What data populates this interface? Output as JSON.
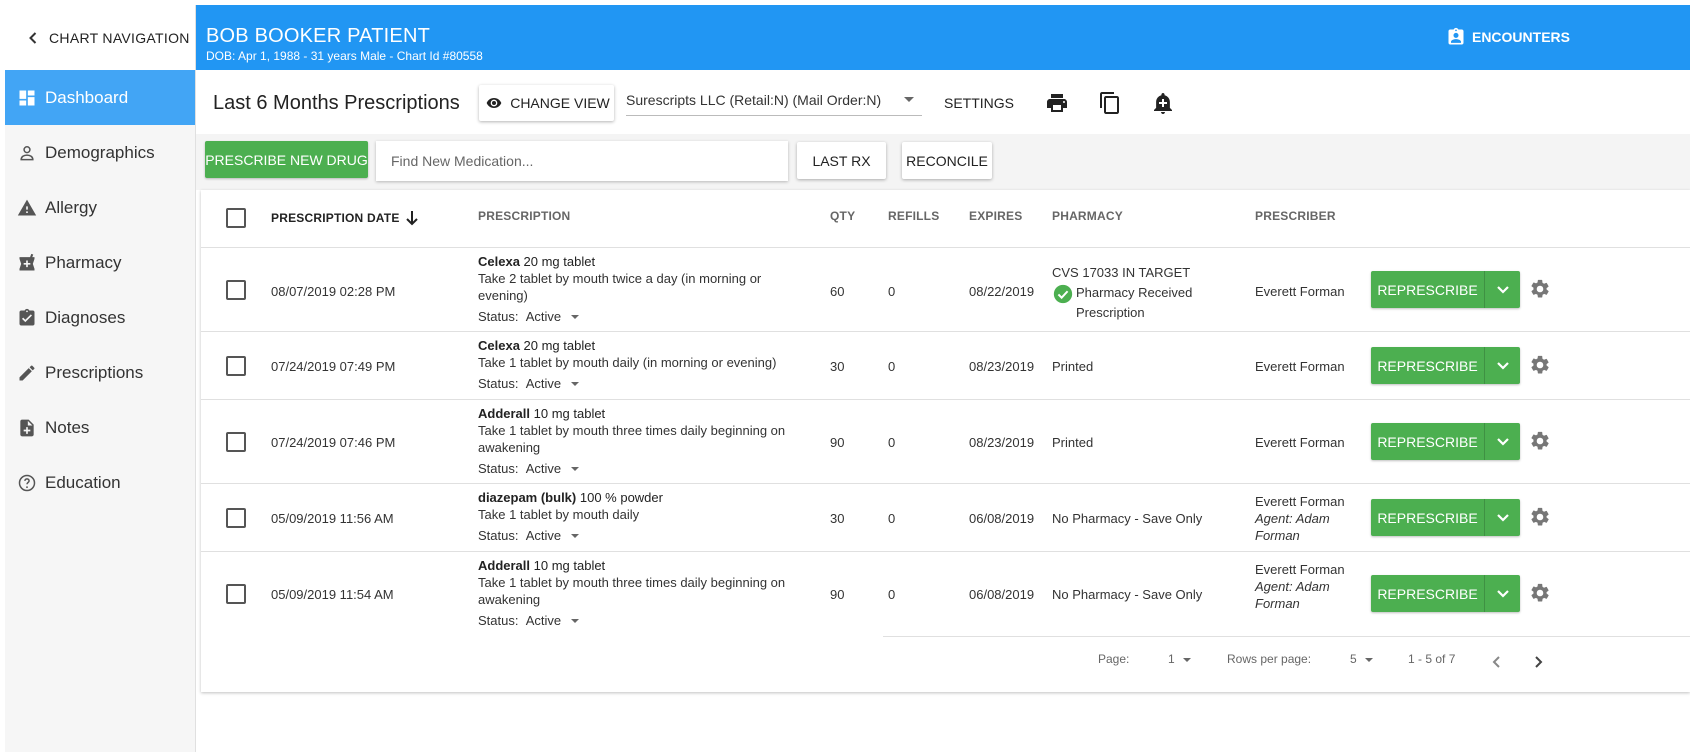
{
  "sidebar": {
    "chart_nav_label": "CHART NAVIGATION",
    "items": [
      {
        "label": "Dashboard",
        "icon": "dashboard-icon",
        "active": true
      },
      {
        "label": "Demographics",
        "icon": "person-icon",
        "active": false
      },
      {
        "label": "Allergy",
        "icon": "warning-icon",
        "active": false
      },
      {
        "label": "Pharmacy",
        "icon": "pharmacy-icon",
        "active": false
      },
      {
        "label": "Diagnoses",
        "icon": "clipboard-check-icon",
        "active": false
      },
      {
        "label": "Prescriptions",
        "icon": "pencil-icon",
        "active": false
      },
      {
        "label": "Notes",
        "icon": "note-add-icon",
        "active": false
      },
      {
        "label": "Education",
        "icon": "help-circle-icon",
        "active": false
      }
    ]
  },
  "header": {
    "patient_name": "BOB BOOKER PATIENT",
    "patient_meta": "DOB: Apr 1, 1988 - 31 years Male - Chart Id #80558",
    "encounters_label": "ENCOUNTERS"
  },
  "toolbar": {
    "title": "Last 6 Months Prescriptions",
    "change_view_label": "CHANGE VIEW",
    "pharmacy_select_value": "Surescripts LLC (Retail:N) (Mail Order:N)",
    "settings_label": "SETTINGS",
    "icons": [
      "print-icon",
      "copy-icon",
      "add-alert-icon"
    ]
  },
  "actions": {
    "prescribe_new_label": "PRESCRIBE NEW DRUG",
    "find_placeholder": "Find New Medication...",
    "last_rx_label": "LAST RX",
    "reconcile_label": "RECONCILE"
  },
  "table": {
    "columns": [
      "PRESCRIPTION DATE",
      "PRESCRIPTION",
      "QTY",
      "REFILLS",
      "EXPIRES",
      "PHARMACY",
      "PRESCRIBER"
    ],
    "sort_column": "PRESCRIPTION DATE",
    "sort_direction": "descending",
    "represcribe_label": "REPRESCRIBE",
    "rows": [
      {
        "date": "08/07/2019 02:28 PM",
        "drug_name": "Celexa",
        "drug_strength": " 20 mg tablet",
        "sig": "Take 2 tablet by mouth twice a day (in morning or evening)",
        "status_label": "Status:",
        "status": "Active",
        "qty": "60",
        "refills": "0",
        "expires": "08/22/2019",
        "pharmacy": "CVS 17033 IN TARGET",
        "pharmacy_status": "Pharmacy Received Prescription",
        "prescriber": "Everett Forman",
        "agent": ""
      },
      {
        "date": "07/24/2019 07:49 PM",
        "drug_name": "Celexa",
        "drug_strength": " 20 mg tablet",
        "sig": "Take 1 tablet by mouth daily (in morning or evening)",
        "status_label": "Status:",
        "status": "Active",
        "qty": "30",
        "refills": "0",
        "expires": "08/23/2019",
        "pharmacy": "Printed",
        "pharmacy_status": "",
        "prescriber": "Everett Forman",
        "agent": ""
      },
      {
        "date": "07/24/2019 07:46 PM",
        "drug_name": "Adderall",
        "drug_strength": " 10 mg tablet",
        "sig": "Take 1 tablet by mouth three times daily beginning on awakening",
        "status_label": "Status:",
        "status": "Active",
        "qty": "90",
        "refills": "0",
        "expires": "08/23/2019",
        "pharmacy": "Printed",
        "pharmacy_status": "",
        "prescriber": "Everett Forman",
        "agent": ""
      },
      {
        "date": "05/09/2019 11:56 AM",
        "drug_name": "diazepam (bulk)",
        "drug_strength": " 100 % powder",
        "sig": "Take 1 tablet by mouth daily",
        "status_label": "Status:",
        "status": "Active",
        "qty": "30",
        "refills": "0",
        "expires": "06/08/2019",
        "pharmacy": "No Pharmacy - Save Only",
        "pharmacy_status": "",
        "prescriber": "Everett Forman",
        "agent": "Agent: Adam Forman"
      },
      {
        "date": "05/09/2019 11:54 AM",
        "drug_name": "Adderall",
        "drug_strength": " 10 mg tablet",
        "sig": "Take 1 tablet by mouth three times daily beginning on awakening",
        "status_label": "Status:",
        "status": "Active",
        "qty": "90",
        "refills": "0",
        "expires": "06/08/2019",
        "pharmacy": "No Pharmacy - Save Only",
        "pharmacy_status": "",
        "prescriber": "Everett Forman",
        "agent": "Agent: Adam Forman"
      }
    ]
  },
  "pagination": {
    "page_label": "Page:",
    "page_value": "1",
    "rows_label": "Rows per page:",
    "rows_value": "5",
    "range_text": "1 - 5 of 7"
  },
  "colors": {
    "header_blue": "#2196f3",
    "active_nav": "#42a5f5",
    "action_green": "#4caf50"
  }
}
